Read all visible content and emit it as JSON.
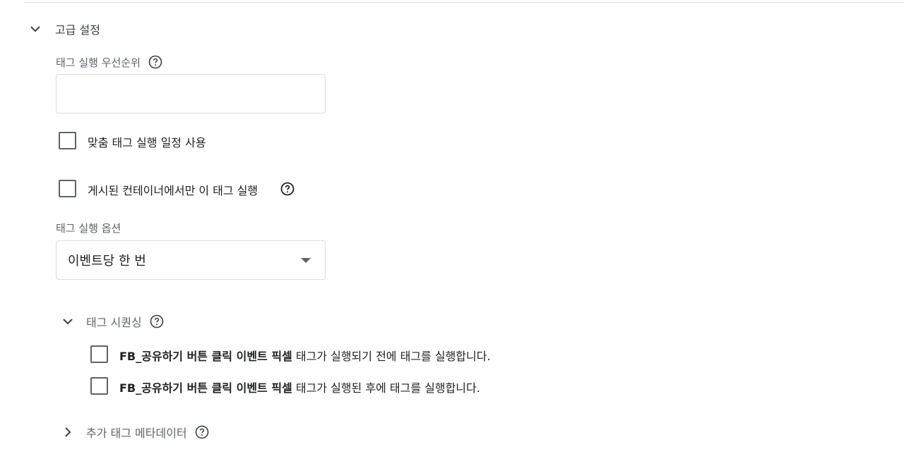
{
  "advanced": {
    "title": "고급 설정",
    "priority_label": "태그 실행 우선순위",
    "priority_value": "",
    "custom_schedule_label": "맞춤 태그 실행 일정 사용",
    "published_only_label": "게시된 컨테이너에서만 이 태그 실행",
    "firing_options_label": "태그 실행 옵션",
    "firing_options_value": "이벤트당 한 번"
  },
  "sequencing": {
    "title": "태그 시퀀싱",
    "before": {
      "tag_name": "FB_공유하기 버튼 클릭 이벤트 픽셀",
      "text": " 태그가 실행되기 전에 태그를 실행합니다."
    },
    "after": {
      "tag_name": "FB_공유하기 버튼 클릭 이벤트 픽셀",
      "text": " 태그가 실행된 후에 태그를 실행합니다."
    }
  },
  "metadata": {
    "title": "추가 태그 메타데이터"
  },
  "icons": {
    "help": "help-circle-icon",
    "expand": "chevron-down-icon",
    "collapse": "chevron-right-icon"
  }
}
